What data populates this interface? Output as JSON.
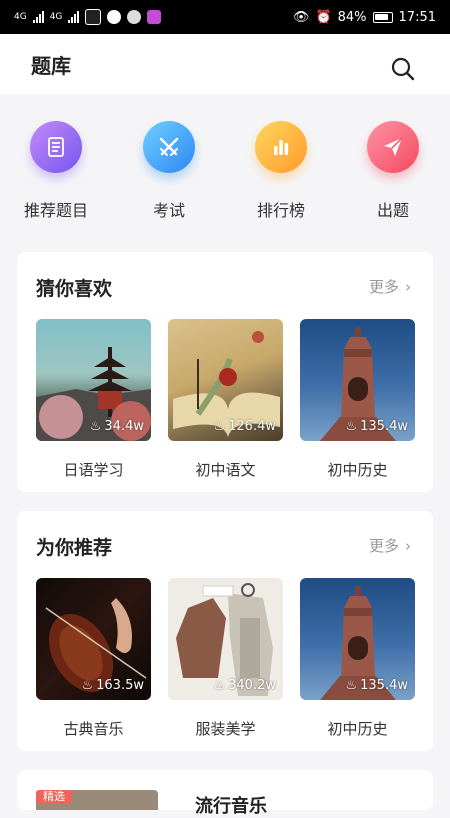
{
  "status_bar": {
    "signal1": "4G",
    "signal2": "4G",
    "battery": "84%",
    "time": "17:51"
  },
  "header": {
    "title": "题库",
    "search_icon": "search-icon"
  },
  "categories": [
    {
      "label": "推荐题目",
      "icon": "list-icon",
      "color_from": "#b37cf5",
      "color_to": "#7b5cf0"
    },
    {
      "label": "考试",
      "icon": "crossed-swords-icon",
      "color_from": "#62c6ff",
      "color_to": "#2f8ff5"
    },
    {
      "label": "排行榜",
      "icon": "bar-chart-icon",
      "color_from": "#ffd15a",
      "color_to": "#ff9a2a"
    },
    {
      "label": "出题",
      "icon": "paper-plane-icon",
      "color_from": "#ff8aa0",
      "color_to": "#f74a60"
    }
  ],
  "guess": {
    "title": "猜你喜欢",
    "more": "更多",
    "items": [
      {
        "label": "日语学习",
        "count": "34.4w"
      },
      {
        "label": "初中语文",
        "count": "126.4w"
      },
      {
        "label": "初中历史",
        "count": "135.4w"
      }
    ]
  },
  "recommend": {
    "title": "为你推荐",
    "more": "更多",
    "items": [
      {
        "label": "古典音乐",
        "count": "163.5w"
      },
      {
        "label": "服装美学",
        "count": "340.2w"
      },
      {
        "label": "初中历史",
        "count": "135.4w"
      }
    ]
  },
  "next_card": {
    "badge": "精选",
    "title": "流行音乐"
  }
}
